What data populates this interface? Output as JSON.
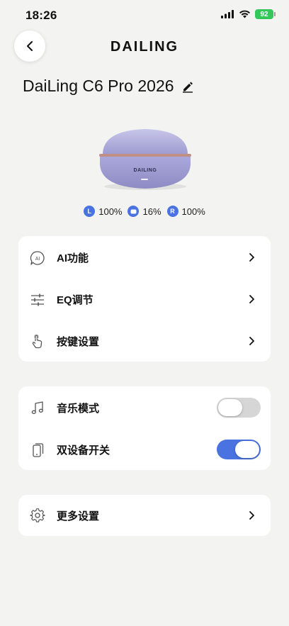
{
  "status_bar": {
    "time": "18:26",
    "battery": "92"
  },
  "header": {
    "brand": "DAILING",
    "device_name": "DaiLing C6 Pro 2026"
  },
  "device": {
    "case_brand": "DAILING"
  },
  "battery": {
    "left": {
      "badge": "L",
      "value": "100%"
    },
    "case": {
      "value": "16%"
    },
    "right": {
      "badge": "R",
      "value": "100%"
    }
  },
  "menu_group1": [
    {
      "label": "AI功能",
      "icon": "ai-chat-icon"
    },
    {
      "label": "EQ调节",
      "icon": "sliders-icon"
    },
    {
      "label": "按键设置",
      "icon": "touch-hand-icon"
    }
  ],
  "menu_group2": [
    {
      "label": "音乐模式",
      "icon": "music-note-icon",
      "toggle": false
    },
    {
      "label": "双设备开关",
      "icon": "dual-device-icon",
      "toggle": true
    }
  ],
  "menu_group3": [
    {
      "label": "更多设置",
      "icon": "gear-icon"
    }
  ],
  "colors": {
    "accent": "#4a72e0",
    "background": "#f3f3f1",
    "battery_green": "#34c759"
  }
}
